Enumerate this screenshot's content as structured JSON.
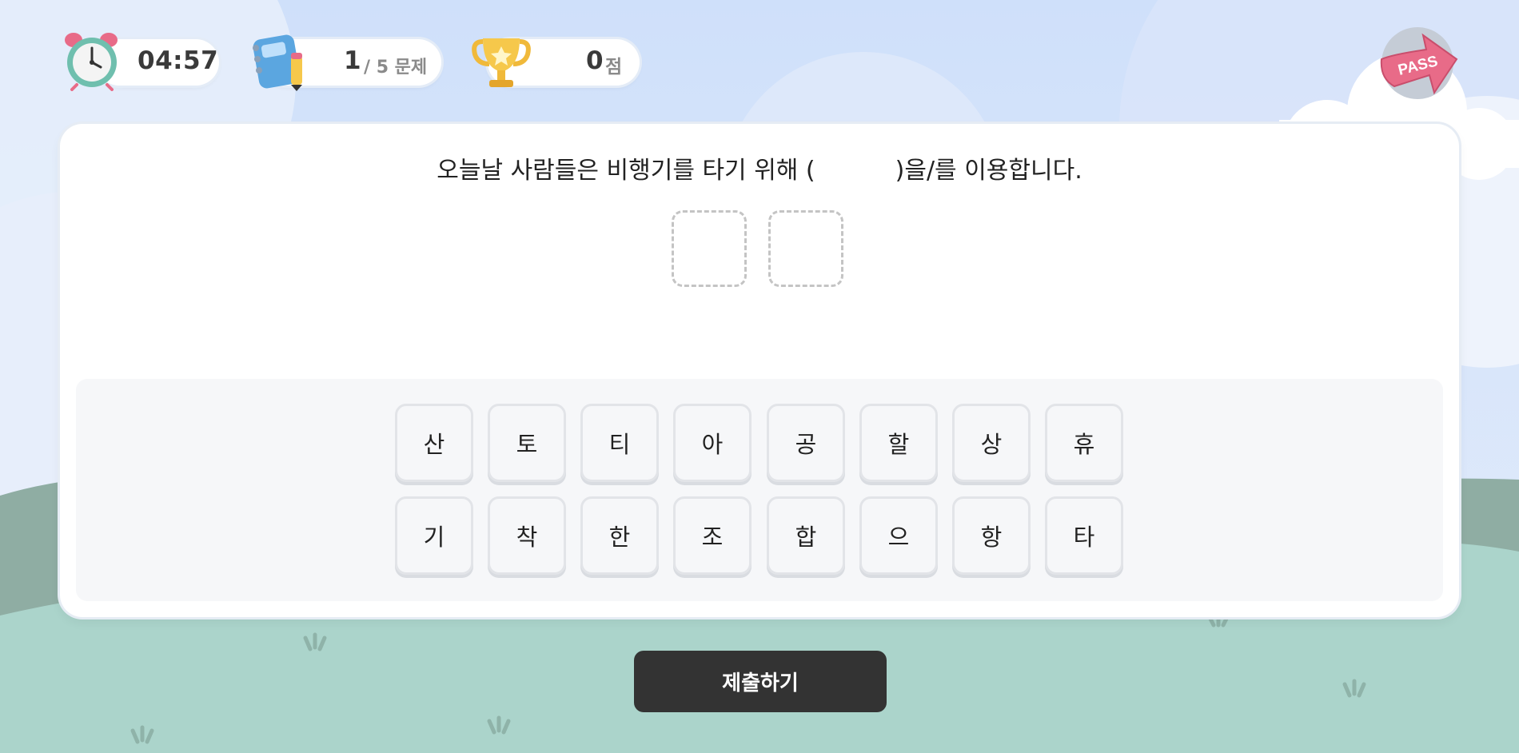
{
  "hud": {
    "timer": "04:57",
    "question_current": "1",
    "question_total": "/ 5 문제",
    "score": "0",
    "score_unit": "점"
  },
  "pass_button_label": "PASS",
  "question": {
    "before": "오늘날 사람들은 비행기를 타기 위해 (",
    "after": ")을/를 이용합니다."
  },
  "answer_slots": [
    "",
    ""
  ],
  "tiles": [
    [
      "산",
      "토",
      "티",
      "아",
      "공",
      "할",
      "상",
      "휴"
    ],
    [
      "기",
      "착",
      "한",
      "조",
      "합",
      "으",
      "항",
      "타"
    ]
  ],
  "submit_label": "제출하기",
  "colors": {
    "sky": "#d4e4fb",
    "hill_dark": "#8fada3",
    "hill_light": "#abd4cb",
    "submit_bg": "#333333",
    "pass_arrow": "#e86b88"
  }
}
